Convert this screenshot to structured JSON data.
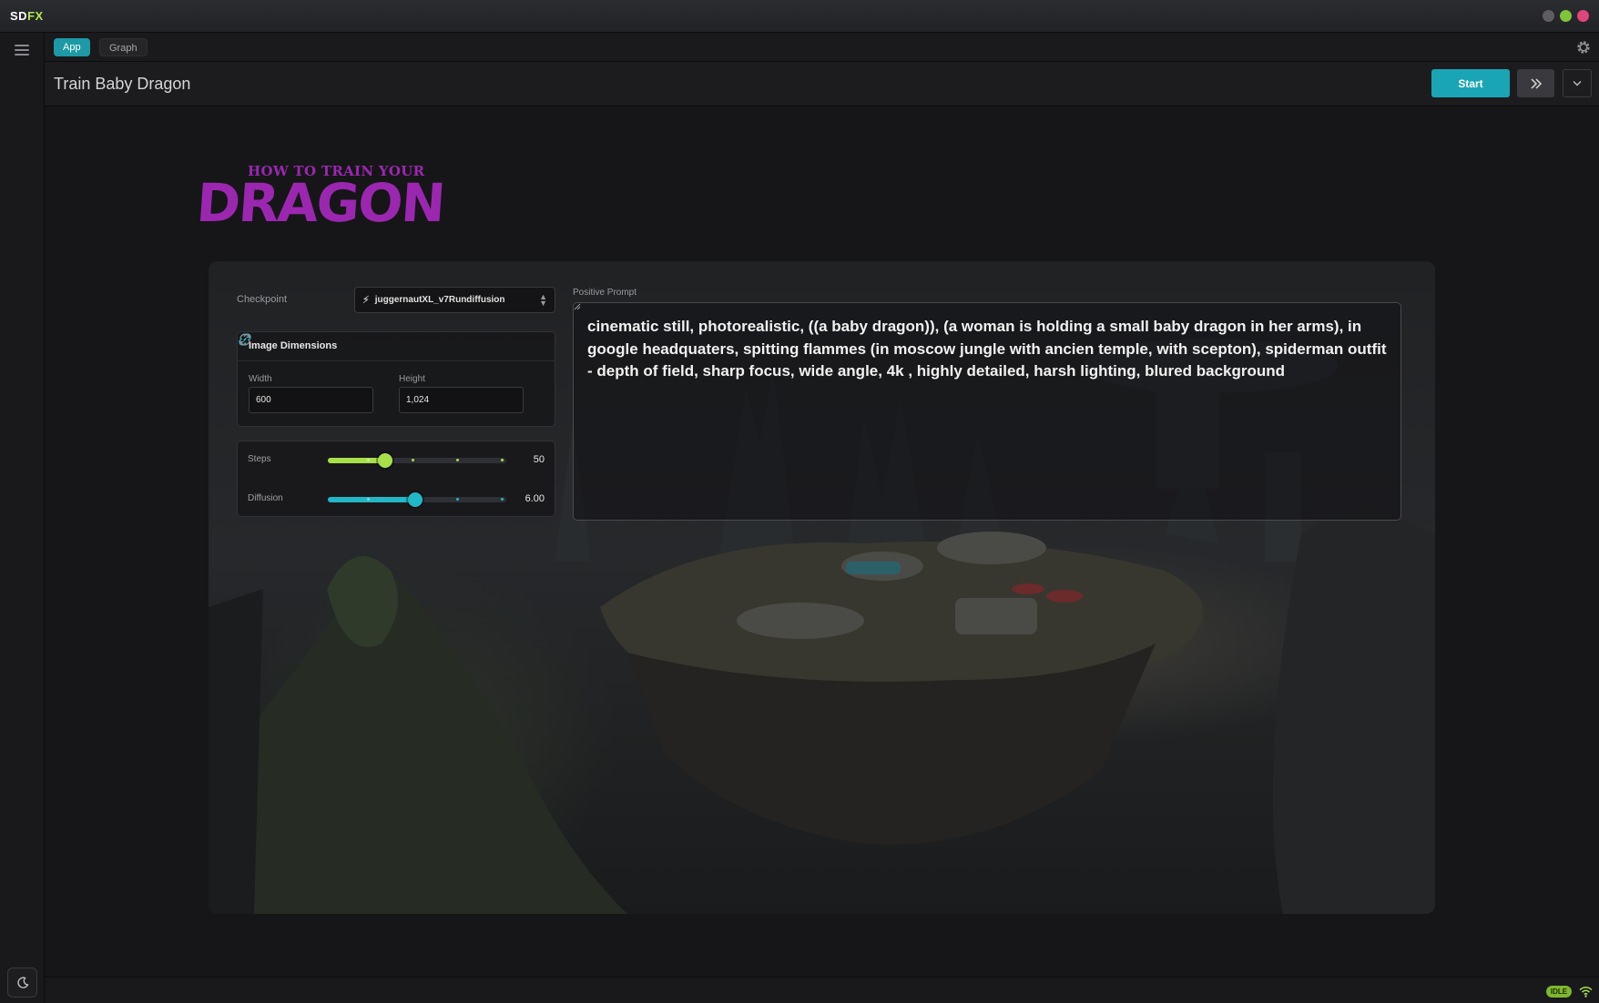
{
  "app": {
    "brand_sd": "SD",
    "brand_fx": "FX",
    "window_controls": {
      "minimize_color": "#5e5e62",
      "maximize_color": "#7fc43a",
      "close_color": "#e0457b"
    }
  },
  "tabs": [
    {
      "label": "App",
      "active": true
    },
    {
      "label": "Graph",
      "active": false
    }
  ],
  "header": {
    "title": "Train Baby Dragon",
    "start_label": "Start",
    "accent_color": "#1aa5b4"
  },
  "logo": {
    "line1": "HOW TO TRAIN YOUR",
    "line2": "DRAGON",
    "color": "#9b27b0"
  },
  "form": {
    "checkpoint": {
      "label": "Checkpoint",
      "value": "juggernautXL_v7Rundiffusion"
    },
    "dimensions": {
      "title": "Image Dimensions",
      "width_label": "Width",
      "width_value": "600",
      "height_label": "Height",
      "height_value": "1,024"
    },
    "steps": {
      "label": "Steps",
      "value": "50",
      "fraction": 0.32,
      "color": "#a8e04a"
    },
    "diffusion": {
      "label": "Diffusion",
      "value": "6.00",
      "fraction": 0.49,
      "color": "#22b7c6"
    },
    "prompt": {
      "label": "Positive Prompt",
      "value": "cinematic still, photorealistic, ((a baby dragon)), (a woman is holding a small baby dragon in her arms), in google headquaters, spitting flammes (in moscow jungle with ancien temple, with scepton), spiderman outfit - depth of field, sharp focus, wide angle, 4k , highly detailed, harsh lighting, blured background"
    }
  },
  "status": {
    "state": "IDLE",
    "state_color": "#7fb82a"
  },
  "icons": [
    "menu-icon",
    "gear-icon",
    "fast-forward-icon",
    "chevron-down-icon",
    "lightning-icon",
    "link-icon",
    "swap-icon",
    "moon-icon",
    "wifi-icon"
  ]
}
